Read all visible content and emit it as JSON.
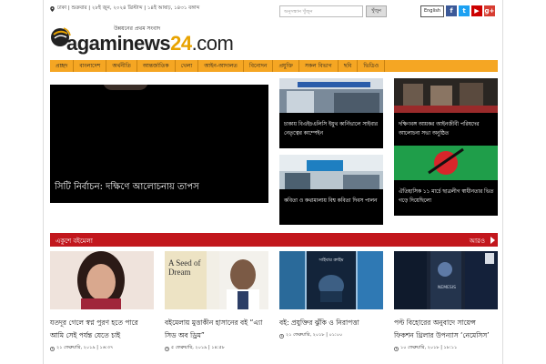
{
  "topbar": {
    "info": "ঢাকা | শুক্রবার | ২৮ই জুন, ২০২৪ খ্রিস্টাব্দ | ১৪ই আষাঢ়, ১৪৩১ বঙ্গাব্দ",
    "search_placeholder": "অনুসন্ধান খুঁজুন",
    "search_button": "খুঁজুন",
    "english_button": "English",
    "social": [
      "f",
      "t",
      "▶",
      "g+"
    ]
  },
  "logo": {
    "tagline": "উন্নয়নের প্রথম সংবাদ",
    "name_a": "agaminews",
    "name_num": "24",
    "name_tld": ".com"
  },
  "nav": {
    "items": [
      "প্রচ্ছদ",
      "বাংলাদেশ",
      "অর্থনীতি",
      "আন্তর্জাতিক",
      "খেলা",
      "আইন-আদালত",
      "বিনোদন",
      "প্রযুক্তি",
      "সকল বিভাগ",
      "ছবি",
      "ভিডিও"
    ]
  },
  "hero": {
    "title": "সিটি নির্বাচন: দক্ষিণে আলোচনায় তাপস"
  },
  "tiles": [
    {
      "title": "চাকায় বিএইচএলিসি ইয়ুথ কার্নিভালে সাইবার নেতৃত্বের কাম্পেইন"
    },
    {
      "title": "দক্ষিণবঙ্গ আয়কর আইনজীবী পরিষদের আলোচনা সভা অনুষ্ঠিত"
    },
    {
      "title": "কবিতা ও কথামালায় বিশ্ব কবিতা দিবস পালন"
    },
    {
      "title": "ঐতিহাসিক ১১ মার্চে ছাত্রলীগ স্বাধীনতার ভিত গড়ে দিয়েছিলো"
    }
  ],
  "section": {
    "title": "একুশে বইমেলা",
    "more": "আরও"
  },
  "cards": [
    {
      "title": "যতদূর গেলে স্বপ্ন পুরণ হতে পারে আমি সেই পর্যন্ত যেতে চাই",
      "date": "২১ ফেব্রুয়ারি, ২০১৯ | ১৬:৩৭"
    },
    {
      "title": "বইমেলায় মুত্তাকীন হাসানের বই “এ্যা সিড অব ড্রিম”",
      "date": "৫ ফেব্রুয়ারি, ২০১৯ | ১৪:৫৮",
      "book_text": "A Seed of Dream"
    },
    {
      "title": "বই: প্রযুক্তির ঝুঁকি ও নিরাপত্তা",
      "date": "২১ ফেব্রুয়ারি, ২০১৮ | ০১:০০",
      "book_text": "সাইবার ক্রাইম"
    },
    {
      "title": "পল্ট বিহোরের অনুবাদে সায়েন্স ফিকশন থ্রিলার উপন্যাস ‘নেমেসিস’",
      "date": "১০ ফেব্রুয়ারি, ২০১৮ | ১৮:১১",
      "book_text": "NEMESIS"
    }
  ],
  "colors": {
    "nav": "#f5a623",
    "section": "#c2171d",
    "logo_accent": "#e8a300"
  }
}
